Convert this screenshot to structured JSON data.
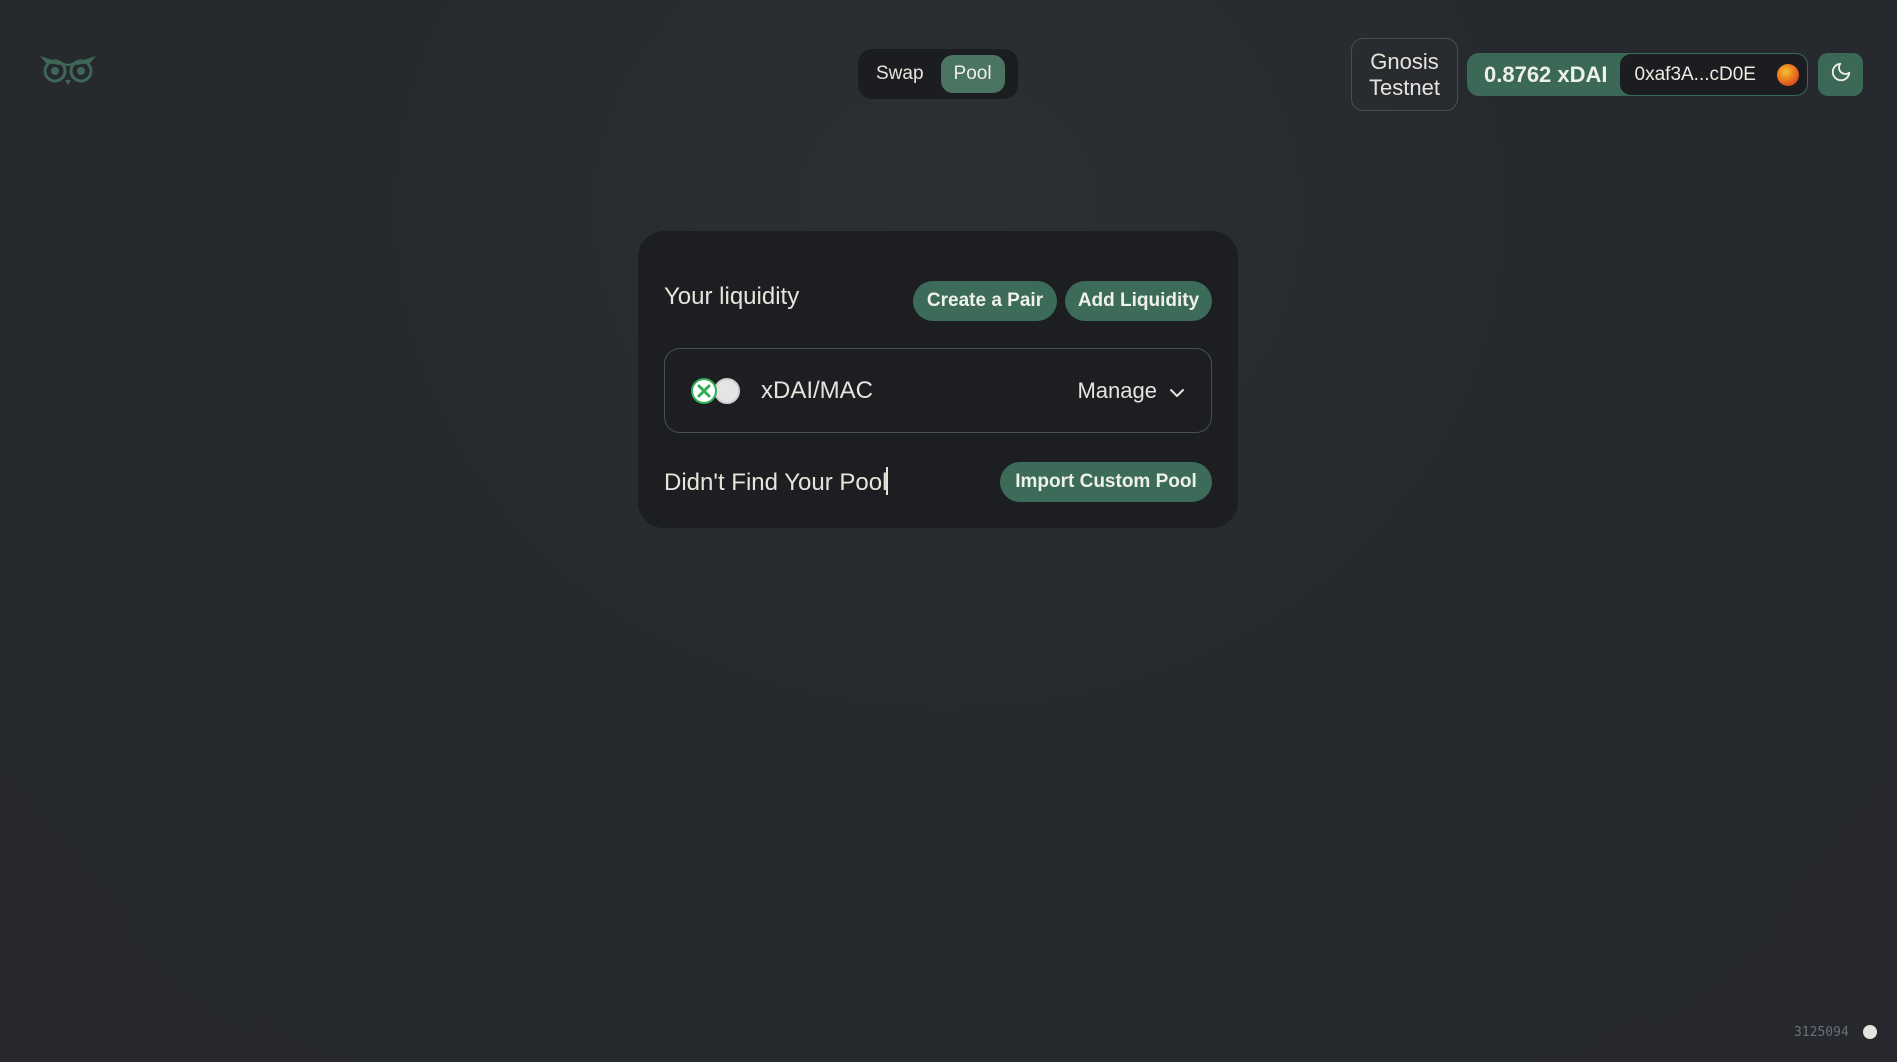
{
  "header": {
    "nav": {
      "swap_label": "Swap",
      "pool_label": "Pool",
      "active": "Pool"
    },
    "network": {
      "line1": "Gnosis",
      "line2": "Testnet"
    },
    "account": {
      "balance": "0.8762 xDAI",
      "address": "0xaf3A...cD0E"
    },
    "icons": {
      "logo": "owl-logo",
      "theme": "moon-icon"
    }
  },
  "liquidity": {
    "title": "Your liquidity",
    "create_pair_label": "Create a Pair",
    "add_liquidity_label": "Add Liquidity",
    "pools": [
      {
        "pair": "xDAI/MAC",
        "manage_label": "Manage"
      }
    ],
    "not_found_text": "Didn't Find Your Pool",
    "import_label": "Import Custom Pool"
  },
  "footer": {
    "block_number": "3125094"
  },
  "colors": {
    "accent": "#3d6b5a",
    "accent_active": "#4a7563",
    "card_bg": "#1c1e22",
    "page_bg": "#26282e",
    "text": "#e8e4dc"
  }
}
